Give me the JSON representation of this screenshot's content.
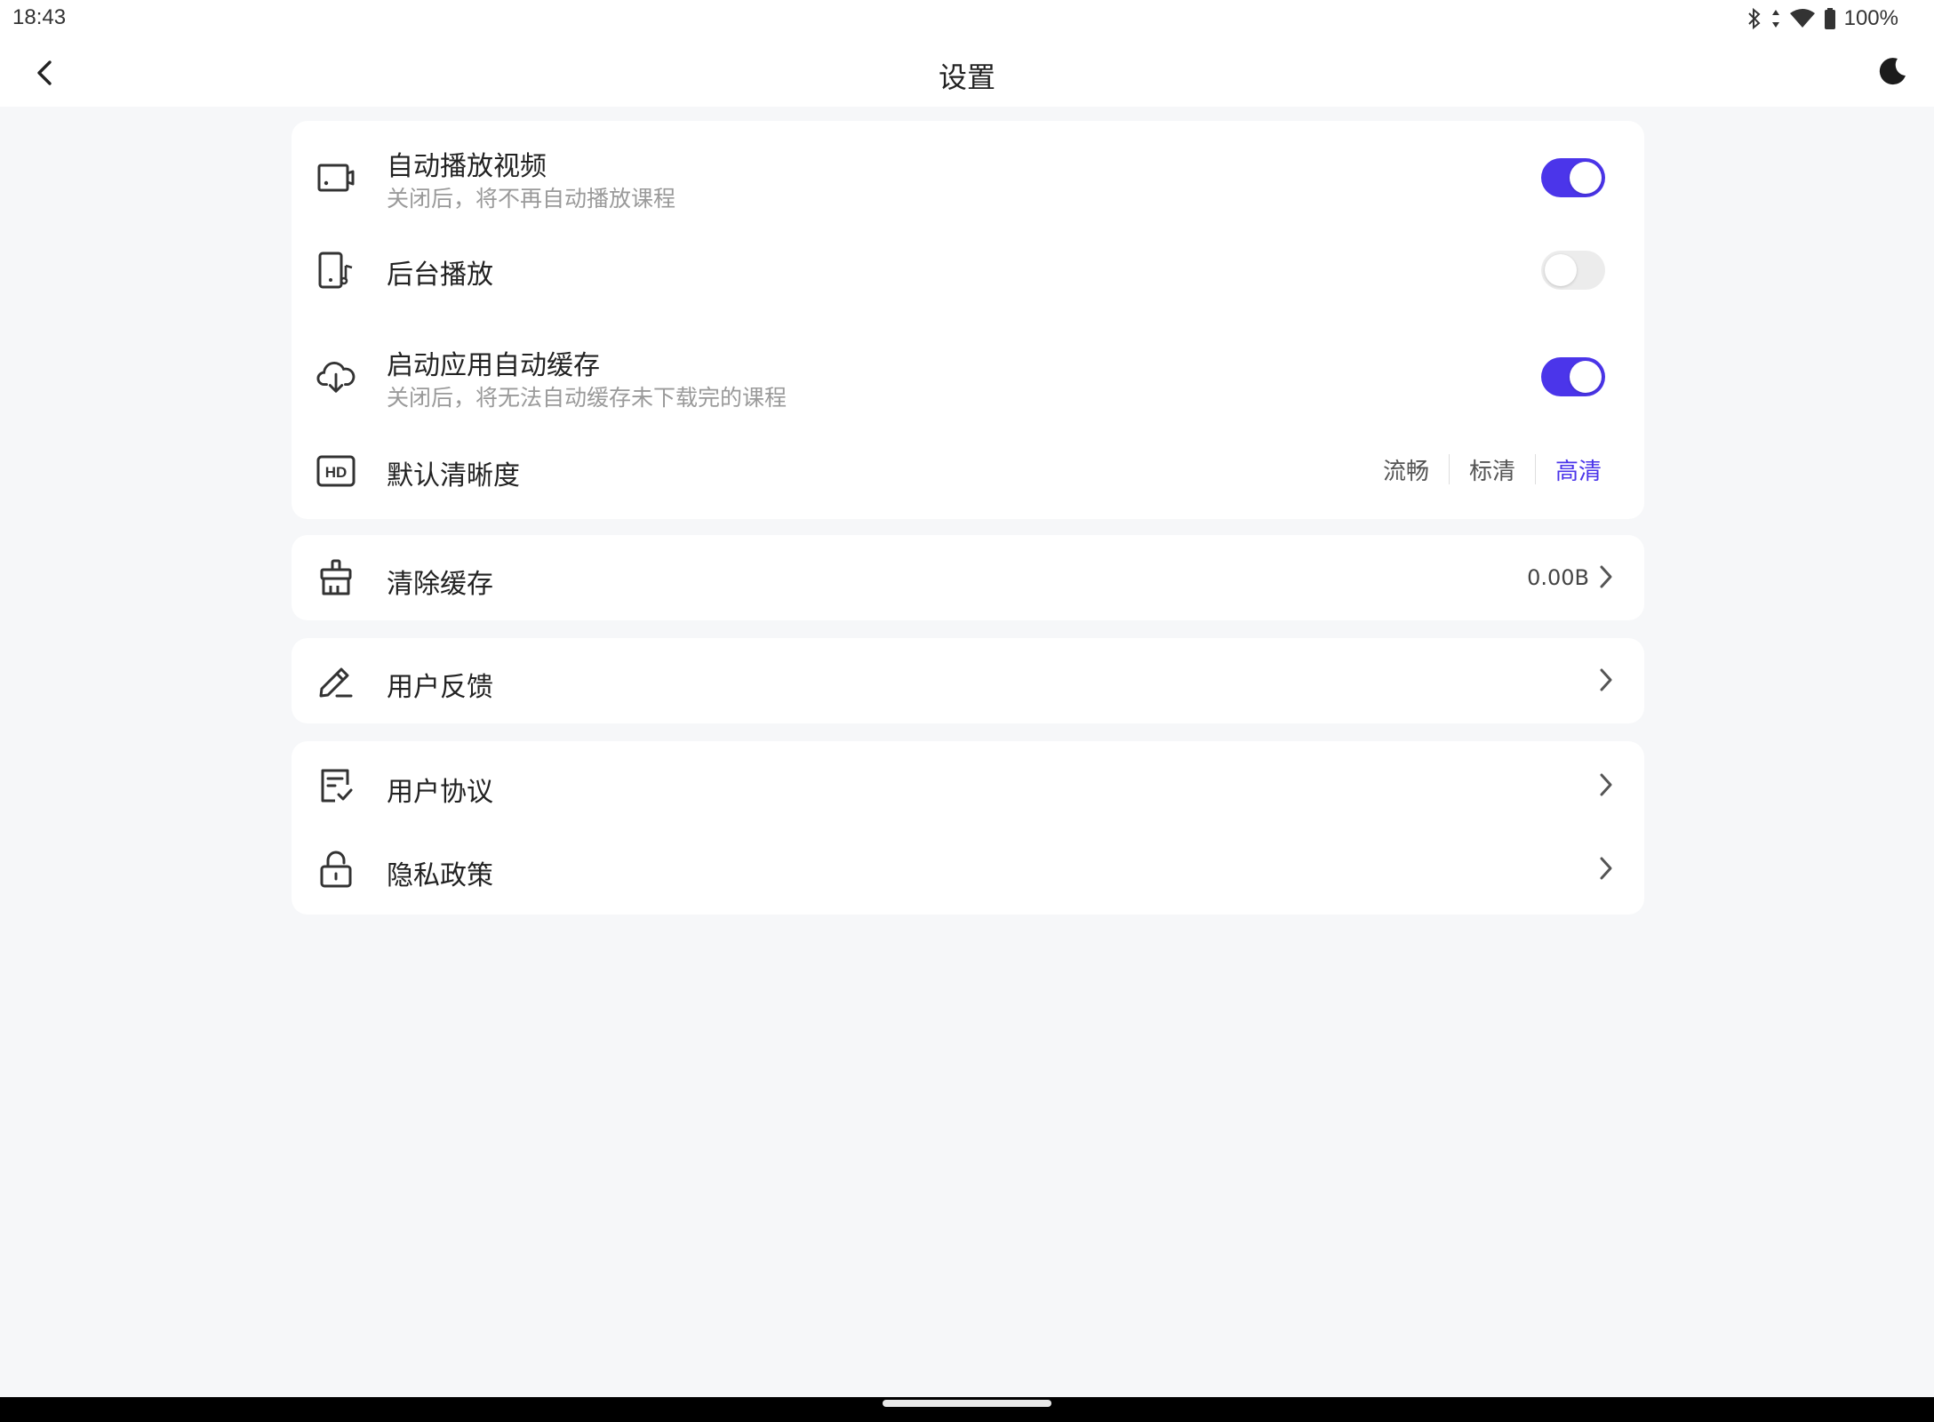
{
  "status_bar": {
    "time": "18:43",
    "battery": "100%",
    "icons": [
      "bluetooth-icon",
      "data-arrows-icon",
      "wifi-icon",
      "battery-icon"
    ]
  },
  "app_bar": {
    "title": "设置",
    "back_icon": "chevron-left-icon",
    "theme_icon": "moon-icon"
  },
  "playback_section": {
    "autoplay": {
      "label": "自动播放视频",
      "subtitle": "关闭后，将不再自动播放课程",
      "enabled": true,
      "icon": "video-icon"
    },
    "background_play": {
      "label": "后台播放",
      "enabled": false,
      "icon": "phone-music-icon"
    },
    "auto_cache": {
      "label": "启动应用自动缓存",
      "subtitle": "关闭后，将无法自动缓存未下载完的课程",
      "enabled": true,
      "icon": "cloud-download-icon"
    },
    "default_quality": {
      "label": "默认清晰度",
      "options": [
        "流畅",
        "标清",
        "高清"
      ],
      "selected": "高清",
      "icon": "hd-icon"
    }
  },
  "cache_section": {
    "label": "清除缓存",
    "value": "0.00B",
    "icon": "broom-icon"
  },
  "feedback_section": {
    "label": "用户反馈",
    "icon": "pencil-icon"
  },
  "legal_section": {
    "agreement": {
      "label": "用户协议",
      "icon": "document-check-icon"
    },
    "privacy": {
      "label": "隐私政策",
      "icon": "lock-icon"
    }
  },
  "colors": {
    "accent": "#4b35ea",
    "background": "#f6f7f9",
    "card": "#ffffff",
    "subtitle": "#9a9a9a"
  }
}
